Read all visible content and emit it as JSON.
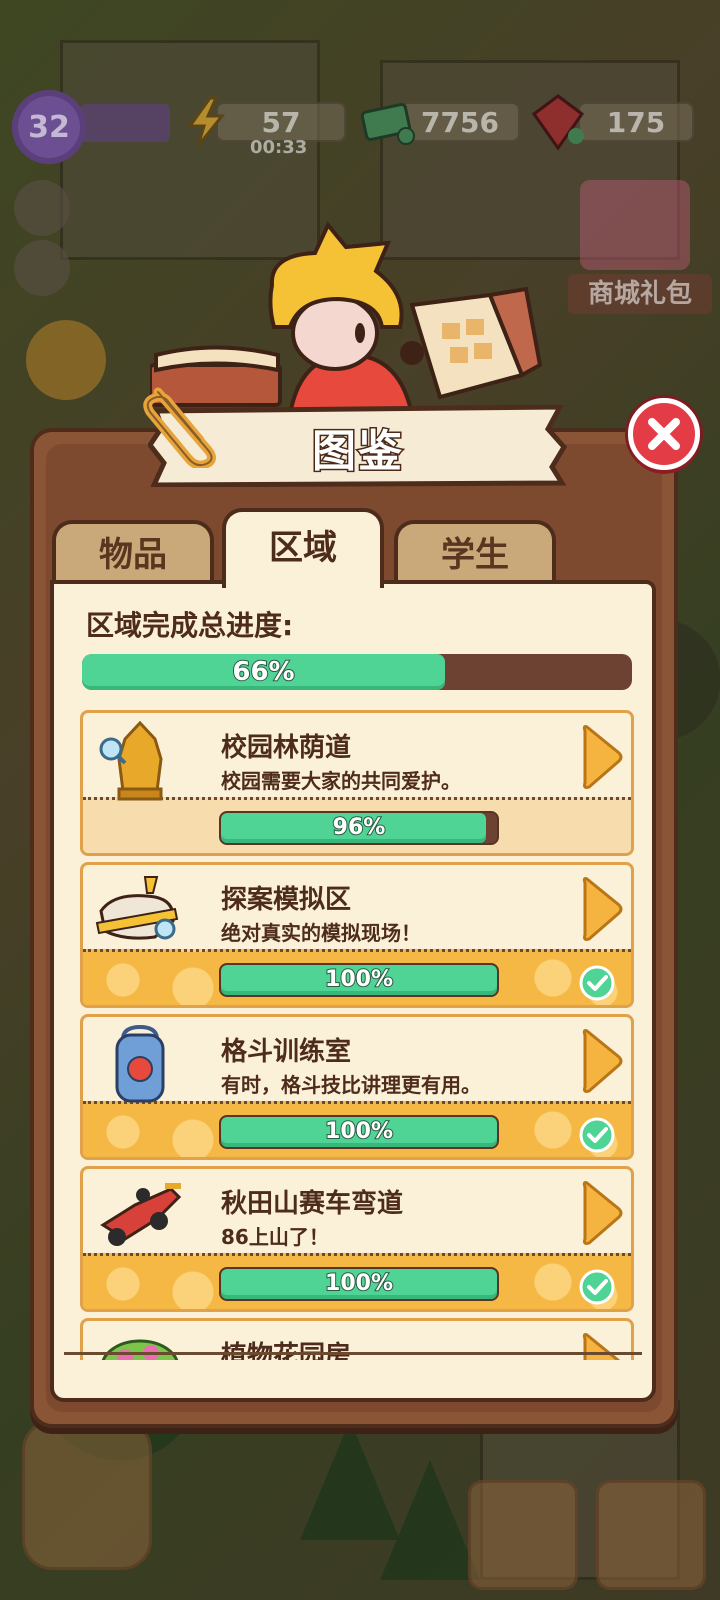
{
  "hud": {
    "level": "32",
    "energy": "57",
    "energy_timer": "00:33",
    "cash": "7756",
    "gems": "175",
    "shop_label": "商城礼包"
  },
  "panel": {
    "title": "图鉴",
    "tabs": [
      {
        "label": "物品",
        "active": false
      },
      {
        "label": "区域",
        "active": true
      },
      {
        "label": "学生",
        "active": false
      }
    ],
    "total_label": "区域完成总进度:",
    "total_progress": 66,
    "total_progress_text": "66%"
  },
  "areas": [
    {
      "name": "校园林荫道",
      "desc": "校园需要大家的共同爱护。",
      "progress": 96,
      "progress_text": "96%",
      "completed": false,
      "icon": "golden-statue-icon"
    },
    {
      "name": "探案模拟区",
      "desc": "绝对真实的模拟现场！",
      "progress": 100,
      "progress_text": "100%",
      "completed": true,
      "icon": "crime-scene-icon"
    },
    {
      "name": "格斗训练室",
      "desc": "有时，格斗技比讲理更有用。",
      "progress": 100,
      "progress_text": "100%",
      "completed": true,
      "icon": "punching-bag-icon"
    },
    {
      "name": "秋田山赛车弯道",
      "desc": "86上山了！",
      "progress": 100,
      "progress_text": "100%",
      "completed": true,
      "icon": "race-car-icon"
    },
    {
      "name": "植物花园房",
      "desc": "",
      "progress": null,
      "progress_text": "",
      "completed": false,
      "icon": "flower-bush-icon"
    }
  ],
  "colors": {
    "panel_brown": "#8a5436",
    "content_cream": "#fbf0d8",
    "progress_green": "#4fd495",
    "card_border": "#e0a14a",
    "close_red": "#e43c47"
  }
}
